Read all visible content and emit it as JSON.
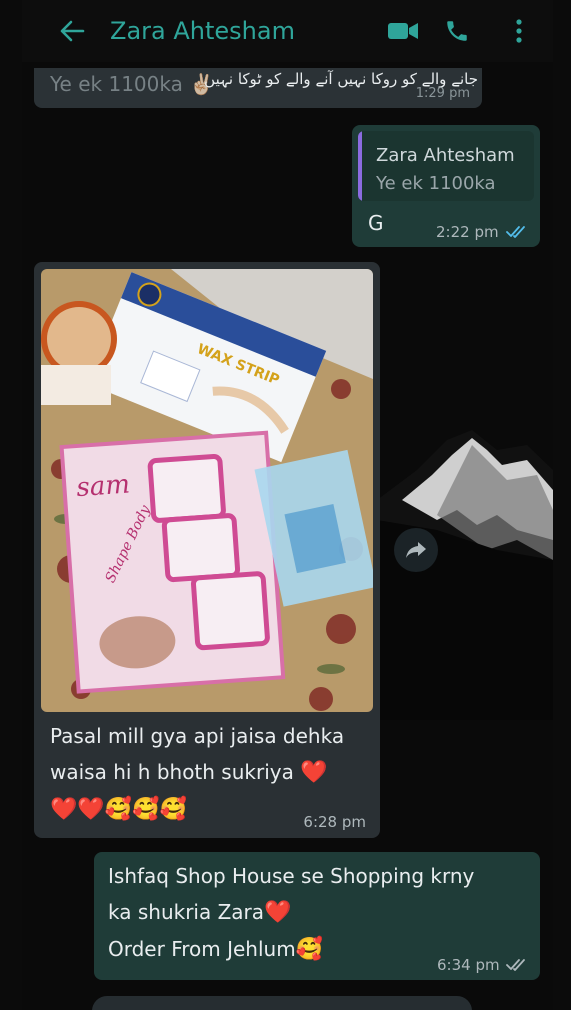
{
  "header": {
    "contact_name": "Zara Ahtesham"
  },
  "messages": {
    "first": {
      "reply_line": "Ye ek 1100ka ✌🏻",
      "urdu_text": "جانے والے کو روکا نہیں آنے والے کو ٹوکا نہیں",
      "time": "1:29 pm"
    },
    "reply_g": {
      "quote_author": "Zara Ahtesham",
      "quote_text": "Ye ek 1100ka",
      "text": "G",
      "time": "2:22 pm"
    },
    "photo_msg": {
      "line1": "Pasal mill gya api jaisa dehka",
      "line2": "waisa hi h  bhoth  sukriya",
      "emoji_end1": "❤️",
      "emoji_row": "❤️❤️🥰🥰🥰",
      "time": "6:28 pm",
      "photo_labels": {
        "wax_strip": "WAX STRIP",
        "brand": "sam",
        "shape": "Shape Body"
      }
    },
    "thanks": {
      "line1": "Ishfaq Shop House se Shopping krny",
      "line2": "ka shukria Zara",
      "heart": "❤️",
      "line3": "Order From Jehlum",
      "emoji3": "🥰",
      "time": "6:34 pm"
    }
  },
  "colors": {
    "accent": "#2fa59a",
    "incoming_bubble": "#262d31",
    "outgoing_bubble": "#1f3c38",
    "read_ticks": "#53bdeb",
    "delivered_ticks": "#aeb8bc"
  },
  "icons": [
    "back-arrow-icon",
    "video-call-icon",
    "phone-call-icon",
    "more-options-icon",
    "forward-icon",
    "read-receipt-icon",
    "delivered-receipt-icon"
  ]
}
